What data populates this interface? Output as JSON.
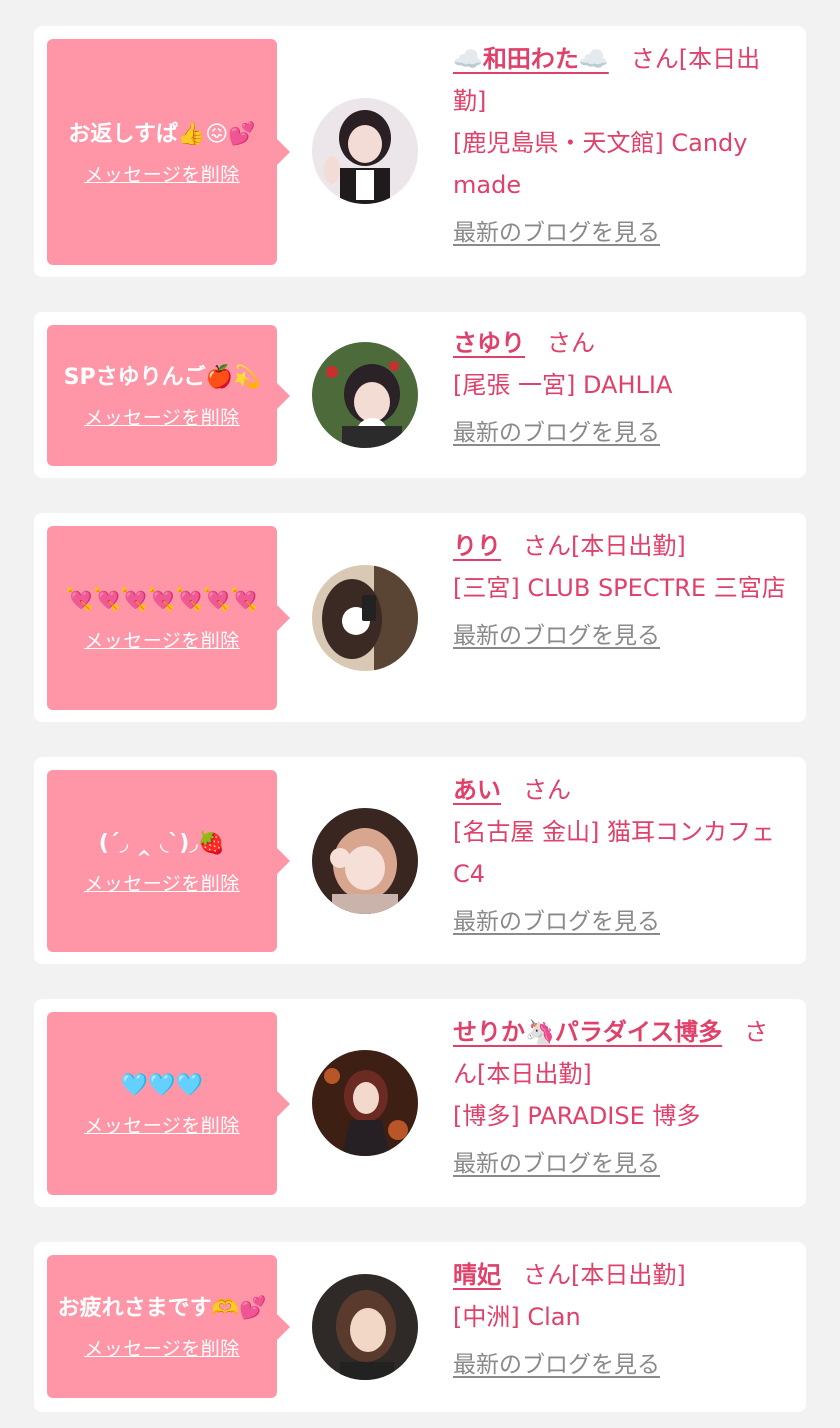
{
  "delete_label": "メッセージを削除",
  "blog_label": "最新のブログを見る",
  "honorific": "さん",
  "colors": {
    "background": "#f2f2f2",
    "bubble": "#ff96a8",
    "name": "#e0416a",
    "link_gray": "#8a8a8a"
  },
  "entries": [
    {
      "message": "お返しすぱ👍😖💕",
      "name": "☁️和田わた☁️",
      "status": "[本日出勤]",
      "shop": "[鹿児島県・天文館] Candy made"
    },
    {
      "message": "SPさゆりんご🍎💫",
      "name": "さゆり",
      "status": "",
      "shop": "[尾張 一宮] DAHLIA"
    },
    {
      "message": "💘💘💘💘💘💘💘",
      "name": "りり",
      "status": "[本日出勤]",
      "shop": "[三宮] CLUB SPECTRE 三宮店"
    },
    {
      "message": "(ˊ◞ ‸ ◟ˋ)◞🍓",
      "name": "あい",
      "status": "",
      "shop": "[名古屋 金山] 猫耳コンカフェ C4"
    },
    {
      "message": "🩵🩵🩵",
      "name": "せりか🦄パラダイス博多",
      "status": "[本日出勤]",
      "shop": "[博多] PARADISE 博多"
    },
    {
      "message": "お疲れさまです🫶💕",
      "name": "晴妃",
      "status": "[本日出勤]",
      "shop": "[中洲] Clan"
    }
  ]
}
